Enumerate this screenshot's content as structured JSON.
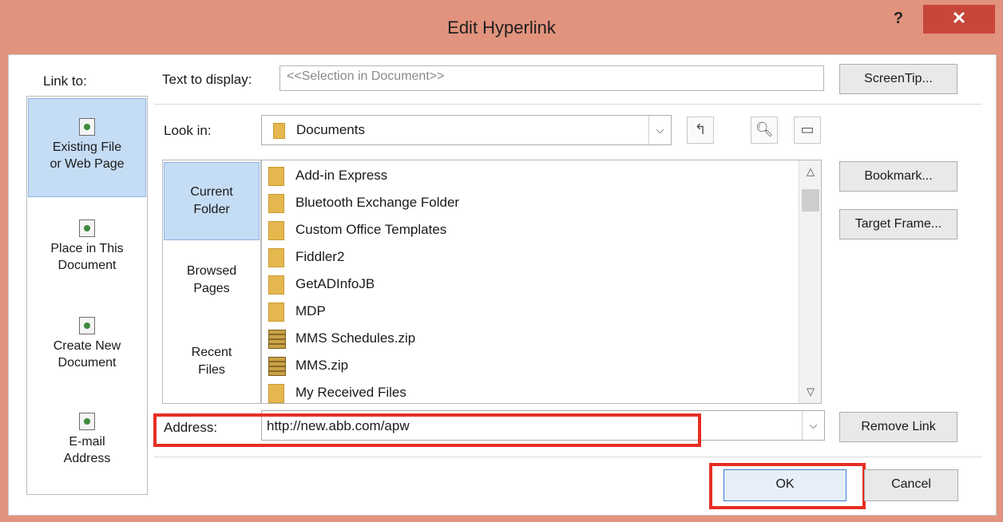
{
  "window": {
    "title": "Edit Hyperlink",
    "help_label": "?",
    "close_label": "✕"
  },
  "link_to": {
    "label": "Link to:",
    "items": [
      {
        "line1": "Existing File",
        "line2": "or Web Page",
        "icon": "file-globe-icon",
        "active": true
      },
      {
        "line1": "Place in This",
        "line2": "Document",
        "icon": "document-place-icon",
        "active": false
      },
      {
        "line1": "Create New",
        "line2": "Document",
        "icon": "new-document-icon",
        "active": false
      },
      {
        "line1": "E-mail",
        "line2": "Address",
        "icon": "email-icon",
        "active": false
      }
    ]
  },
  "text_to_display": {
    "label": "Text to display:",
    "value": "<<Selection in Document>>"
  },
  "buttons": {
    "screentip": "ScreenTip...",
    "bookmark": "Bookmark...",
    "target_frame": "Target Frame...",
    "remove_link": "Remove Link",
    "ok": "OK",
    "cancel": "Cancel"
  },
  "look_in": {
    "label": "Look in:",
    "value": "Documents"
  },
  "sub_nav": [
    {
      "line1": "Current",
      "line2": "Folder",
      "active": true
    },
    {
      "line1": "Browsed",
      "line2": "Pages",
      "active": false
    },
    {
      "line1": "Recent",
      "line2": "Files",
      "active": false
    }
  ],
  "files": [
    {
      "name": "Add-in Express",
      "type": "folder"
    },
    {
      "name": "Bluetooth Exchange Folder",
      "type": "folder"
    },
    {
      "name": "Custom Office Templates",
      "type": "folder"
    },
    {
      "name": "Fiddler2",
      "type": "folder"
    },
    {
      "name": "GetADInfoJB",
      "type": "folder"
    },
    {
      "name": "MDP",
      "type": "folder"
    },
    {
      "name": "MMS Schedules.zip",
      "type": "zip"
    },
    {
      "name": "MMS.zip",
      "type": "zip"
    },
    {
      "name": "My Received Files",
      "type": "folder"
    }
  ],
  "address": {
    "label": "Address:",
    "value": "http://new.abb.com/apw"
  },
  "colors": {
    "title_bar": "#e2937d",
    "close_button": "#c7463a",
    "highlight": "#e62e23",
    "selection": "#c5dcf5"
  }
}
